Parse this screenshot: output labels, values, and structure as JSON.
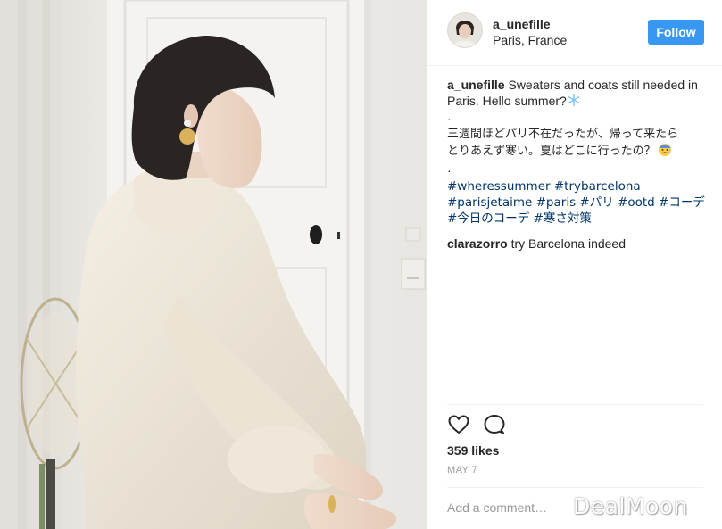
{
  "header": {
    "username": "a_unefille",
    "location": "Paris, France",
    "follow_label": "Follow"
  },
  "caption": {
    "username": "a_unefille",
    "text_en": "Sweaters and coats still needed in Paris. Hello summer?",
    "dot": "·",
    "text_jp_line1": "三週間ほどパリ不在だったが、帰って来たら",
    "text_jp_line2": "とりあえず寒い。夏はどこに行ったの？",
    "hashtags": [
      "#wheressummer",
      "#trybarcelona",
      "#parisjetaime",
      "#paris",
      "#パリ",
      "#ootd",
      "#コーデ",
      "#今日のコーデ",
      "#寒さ対策"
    ]
  },
  "comment": {
    "username": "clarazorro",
    "text": "try Barcelona indeed"
  },
  "actions": {
    "like_icon": "heart-outline-icon",
    "comment_icon": "speech-bubble-icon"
  },
  "likes": "359 likes",
  "date": "MAY 7",
  "add_comment": {
    "placeholder": "Add a comment…"
  },
  "watermark": "DealMoon",
  "colors": {
    "follow_button": "#3897f0",
    "hashtag": "#003569",
    "text": "#262626",
    "muted": "#999999",
    "divider": "#efefef"
  }
}
